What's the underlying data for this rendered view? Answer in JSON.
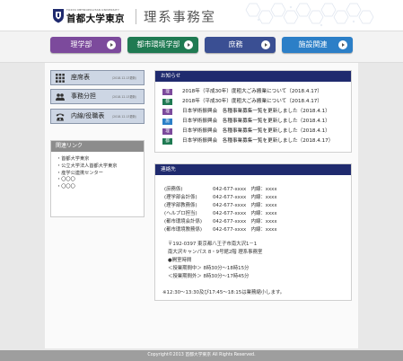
{
  "header": {
    "logo_en": "TOKYO METROPOLITAN UNIVERSITY",
    "logo_ja": "首都大学東京",
    "site_title": "理系事務室"
  },
  "nav": [
    {
      "label": "理学部",
      "color": "#7c4a9c"
    },
    {
      "label": "都市環境学部",
      "color": "#1f7a52"
    },
    {
      "label": "庶務",
      "color": "#3a4f93"
    },
    {
      "label": "施設関連",
      "color": "#2c7fc7"
    }
  ],
  "sidebar": {
    "buttons": [
      {
        "label": "座席表",
        "date": "（2018.12.13更新）",
        "icon": "grid-icon"
      },
      {
        "label": "事務分担",
        "date": "（2018.12.13更新）",
        "icon": "people-icon"
      },
      {
        "label": "内線/役職表",
        "date": "（2018.12.13更新）",
        "icon": "phone-icon"
      }
    ],
    "links_title": "関連リンク",
    "links": [
      "首都大学東京",
      "公立大学法人首都大学東京",
      "産学公連携センター",
      "〇〇〇",
      "〇〇〇"
    ]
  },
  "news": {
    "title": "お知らせ",
    "items": [
      {
        "badge": "理",
        "color": "#7c4a9c",
        "text": "2018年（平成30年）度粗大ごみ搬業について（2018.4.17）"
      },
      {
        "badge": "都",
        "color": "#1f7a52",
        "text": "2018年（平成30年）度粗大ごみ搬業について（2018.4.17）"
      },
      {
        "badge": "理",
        "color": "#7c4a9c",
        "text": "日本学術振興会　各種事業募集一覧を更新しました（2018.4.1）"
      },
      {
        "badge": "施",
        "color": "#2c7fc7",
        "text": "日本学術振興会　各種事業募集一覧を更新しました（2018.4.1）"
      },
      {
        "badge": "理",
        "color": "#7c4a9c",
        "text": "日本学術振興会　各種事業募集一覧を更新しました（2018.4.1）"
      },
      {
        "badge": "都",
        "color": "#1f7a52",
        "text": "日本学術振興会　各種事業募集一覧を更新しました（2018.4.17）"
      }
    ]
  },
  "contact": {
    "title": "連絡先",
    "rows": [
      {
        "name": "(庶務係)",
        "tel": "042-677-xxxx　内線：xxxx"
      },
      {
        "name": "(理学部会計係)",
        "tel": "042-677-xxxx　内線：xxxx"
      },
      {
        "name": "(理学部教務係)",
        "tel": "042-677-xxxx　内線：xxxx"
      },
      {
        "name": "(ヘルプロ担当)",
        "tel": "042-677-xxxx　内線：xxxx"
      },
      {
        "name": "(都市環境会計係)",
        "tel": "042-677-xxxx　内線：xxxx"
      },
      {
        "name": "(都市環境教務係)",
        "tel": "042-677-xxxx　内線：xxxx"
      }
    ],
    "address": [
      "〒192-0397 東京都八王子市南大沢1－1",
      "南大沢キャンパス 8・9号館2階 理系事務室",
      "●開室時間",
      "＜授業期間中＞ 8時30分～18時15分",
      "＜授業期間外＞ 8時30分～17時45分"
    ],
    "note": "※12:30～13:30及び17:45～18:15は業務縮小します。"
  },
  "footer": {
    "copyright": "Copyright©2013 首都大学東京 All Rights Reserved."
  }
}
